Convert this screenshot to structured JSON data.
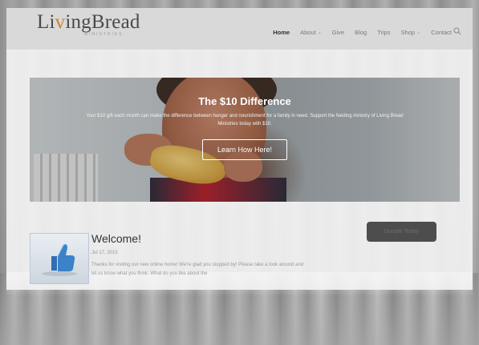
{
  "header": {
    "logo_main_1": "Li",
    "logo_accent": "v",
    "logo_main_2": "ingBread",
    "logo_sub": "MINISTRIES",
    "nav": [
      {
        "label": "Home",
        "active": true,
        "dropdown": false
      },
      {
        "label": "About",
        "active": false,
        "dropdown": true
      },
      {
        "label": "Give",
        "active": false,
        "dropdown": false
      },
      {
        "label": "Blog",
        "active": false,
        "dropdown": false
      },
      {
        "label": "Trips",
        "active": false,
        "dropdown": false
      },
      {
        "label": "Shop",
        "active": false,
        "dropdown": true
      },
      {
        "label": "Contact",
        "active": false,
        "dropdown": false
      }
    ],
    "search_icon": "search-icon"
  },
  "hero": {
    "title": "The $10 Difference",
    "text": "Your $10 gift each month can make the difference between hunger and nourishment for a family in need. Support the feeding ministry of Living Bread Ministries today with $10.",
    "button_label": "Learn How Here!"
  },
  "post": {
    "title": "Welcome!",
    "date": "Jul 17, 2015",
    "excerpt": "Thanks for visiting our new online home! We're glad you stopped by! Please take a look around and let us know what you think. What do you like about the",
    "thumb_icon": "thumbs-up-icon"
  },
  "sidebar": {
    "button_label": "Donate Today"
  },
  "colors": {
    "accent": "#c9892b",
    "header_bg": "#d9d9d9",
    "thumb_blue": "#2f6fb3"
  }
}
